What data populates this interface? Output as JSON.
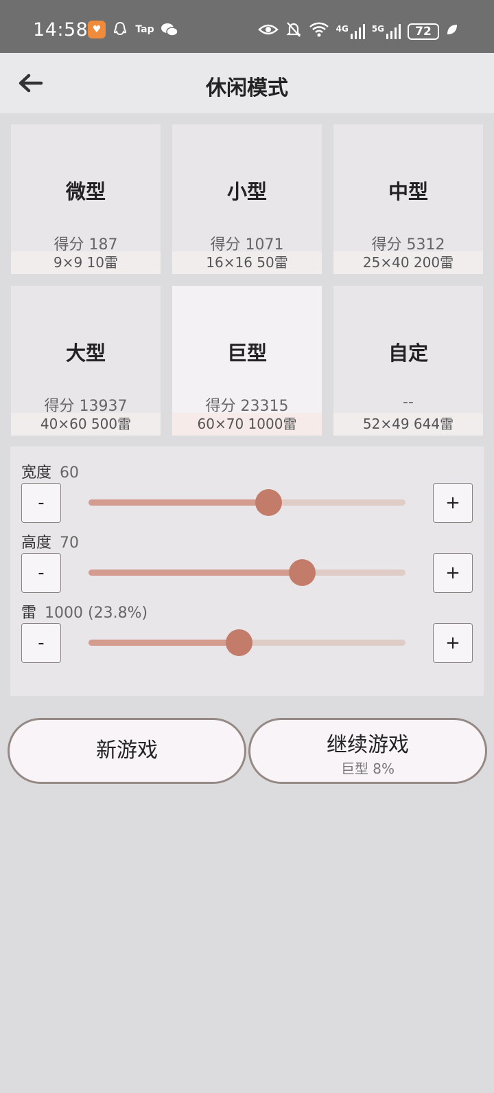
{
  "status_bar": {
    "time": "14:58",
    "left_icons": [
      "heart-app-icon",
      "qq-icon",
      "tap-icon",
      "wechat-icon"
    ],
    "tap_label": "Tap",
    "right_icons": [
      "eye-icon",
      "bell-muted-icon",
      "wifi-icon",
      "signal-4g-icon",
      "signal-5g-icon",
      "battery-icon",
      "leaf-icon"
    ],
    "net1": "4G",
    "net2": "5G",
    "battery": "72"
  },
  "header": {
    "title": "休闲模式",
    "back_icon": "arrow-left-icon"
  },
  "modes": [
    {
      "name": "微型",
      "score": "得分 187",
      "spec": "9×9  10雷"
    },
    {
      "name": "小型",
      "score": "得分 1071",
      "spec": "16×16  50雷"
    },
    {
      "name": "中型",
      "score": "得分 5312",
      "spec": "25×40  200雷"
    },
    {
      "name": "大型",
      "score": "得分 13937",
      "spec": "40×60  500雷"
    },
    {
      "name": "巨型",
      "score": "得分 23315",
      "spec": "60×70  1000雷"
    },
    {
      "name": "自定",
      "score": "--",
      "spec": "52×49  644雷"
    }
  ],
  "selected_mode_index": 4,
  "settings": {
    "width": {
      "label": "宽度",
      "value": "60",
      "slider_fraction": 0.568
    },
    "height": {
      "label": "高度",
      "value": "70",
      "slider_fraction": 0.673
    },
    "mines": {
      "label": "雷",
      "value": "1000 (23.8%)",
      "slider_fraction": 0.475
    },
    "minus_label": "-",
    "plus_label": "+"
  },
  "actions": {
    "new_game": "新游戏",
    "continue_game": "继续游戏",
    "continue_sub": "巨型 8%"
  },
  "colors": {
    "slider_fill": "#d49c8f",
    "slider_track": "#dfccc7",
    "slider_thumb": "#c47c6a"
  }
}
